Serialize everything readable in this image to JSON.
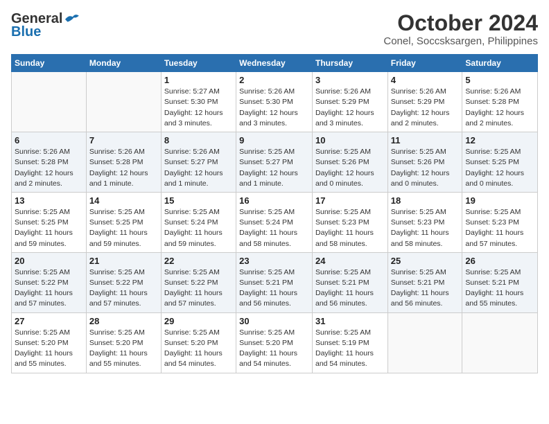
{
  "logo": {
    "general": "General",
    "blue": "Blue"
  },
  "title": "October 2024",
  "subtitle": "Conel, Soccsksargen, Philippines",
  "days_of_week": [
    "Sunday",
    "Monday",
    "Tuesday",
    "Wednesday",
    "Thursday",
    "Friday",
    "Saturday"
  ],
  "weeks": [
    [
      {
        "day": "",
        "info": ""
      },
      {
        "day": "",
        "info": ""
      },
      {
        "day": "1",
        "sunrise": "5:27 AM",
        "sunset": "5:30 PM",
        "daylight": "12 hours and 3 minutes."
      },
      {
        "day": "2",
        "sunrise": "5:26 AM",
        "sunset": "5:30 PM",
        "daylight": "12 hours and 3 minutes."
      },
      {
        "day": "3",
        "sunrise": "5:26 AM",
        "sunset": "5:29 PM",
        "daylight": "12 hours and 3 minutes."
      },
      {
        "day": "4",
        "sunrise": "5:26 AM",
        "sunset": "5:29 PM",
        "daylight": "12 hours and 2 minutes."
      },
      {
        "day": "5",
        "sunrise": "5:26 AM",
        "sunset": "5:28 PM",
        "daylight": "12 hours and 2 minutes."
      }
    ],
    [
      {
        "day": "6",
        "sunrise": "5:26 AM",
        "sunset": "5:28 PM",
        "daylight": "12 hours and 2 minutes."
      },
      {
        "day": "7",
        "sunrise": "5:26 AM",
        "sunset": "5:28 PM",
        "daylight": "12 hours and 1 minute."
      },
      {
        "day": "8",
        "sunrise": "5:26 AM",
        "sunset": "5:27 PM",
        "daylight": "12 hours and 1 minute."
      },
      {
        "day": "9",
        "sunrise": "5:25 AM",
        "sunset": "5:27 PM",
        "daylight": "12 hours and 1 minute."
      },
      {
        "day": "10",
        "sunrise": "5:25 AM",
        "sunset": "5:26 PM",
        "daylight": "12 hours and 0 minutes."
      },
      {
        "day": "11",
        "sunrise": "5:25 AM",
        "sunset": "5:26 PM",
        "daylight": "12 hours and 0 minutes."
      },
      {
        "day": "12",
        "sunrise": "5:25 AM",
        "sunset": "5:25 PM",
        "daylight": "12 hours and 0 minutes."
      }
    ],
    [
      {
        "day": "13",
        "sunrise": "5:25 AM",
        "sunset": "5:25 PM",
        "daylight": "11 hours and 59 minutes."
      },
      {
        "day": "14",
        "sunrise": "5:25 AM",
        "sunset": "5:25 PM",
        "daylight": "11 hours and 59 minutes."
      },
      {
        "day": "15",
        "sunrise": "5:25 AM",
        "sunset": "5:24 PM",
        "daylight": "11 hours and 59 minutes."
      },
      {
        "day": "16",
        "sunrise": "5:25 AM",
        "sunset": "5:24 PM",
        "daylight": "11 hours and 58 minutes."
      },
      {
        "day": "17",
        "sunrise": "5:25 AM",
        "sunset": "5:23 PM",
        "daylight": "11 hours and 58 minutes."
      },
      {
        "day": "18",
        "sunrise": "5:25 AM",
        "sunset": "5:23 PM",
        "daylight": "11 hours and 58 minutes."
      },
      {
        "day": "19",
        "sunrise": "5:25 AM",
        "sunset": "5:23 PM",
        "daylight": "11 hours and 57 minutes."
      }
    ],
    [
      {
        "day": "20",
        "sunrise": "5:25 AM",
        "sunset": "5:22 PM",
        "daylight": "11 hours and 57 minutes."
      },
      {
        "day": "21",
        "sunrise": "5:25 AM",
        "sunset": "5:22 PM",
        "daylight": "11 hours and 57 minutes."
      },
      {
        "day": "22",
        "sunrise": "5:25 AM",
        "sunset": "5:22 PM",
        "daylight": "11 hours and 57 minutes."
      },
      {
        "day": "23",
        "sunrise": "5:25 AM",
        "sunset": "5:21 PM",
        "daylight": "11 hours and 56 minutes."
      },
      {
        "day": "24",
        "sunrise": "5:25 AM",
        "sunset": "5:21 PM",
        "daylight": "11 hours and 56 minutes."
      },
      {
        "day": "25",
        "sunrise": "5:25 AM",
        "sunset": "5:21 PM",
        "daylight": "11 hours and 56 minutes."
      },
      {
        "day": "26",
        "sunrise": "5:25 AM",
        "sunset": "5:21 PM",
        "daylight": "11 hours and 55 minutes."
      }
    ],
    [
      {
        "day": "27",
        "sunrise": "5:25 AM",
        "sunset": "5:20 PM",
        "daylight": "11 hours and 55 minutes."
      },
      {
        "day": "28",
        "sunrise": "5:25 AM",
        "sunset": "5:20 PM",
        "daylight": "11 hours and 55 minutes."
      },
      {
        "day": "29",
        "sunrise": "5:25 AM",
        "sunset": "5:20 PM",
        "daylight": "11 hours and 54 minutes."
      },
      {
        "day": "30",
        "sunrise": "5:25 AM",
        "sunset": "5:20 PM",
        "daylight": "11 hours and 54 minutes."
      },
      {
        "day": "31",
        "sunrise": "5:25 AM",
        "sunset": "5:19 PM",
        "daylight": "11 hours and 54 minutes."
      },
      {
        "day": "",
        "info": ""
      },
      {
        "day": "",
        "info": ""
      }
    ]
  ],
  "labels": {
    "sunrise": "Sunrise:",
    "sunset": "Sunset:",
    "daylight": "Daylight:"
  }
}
